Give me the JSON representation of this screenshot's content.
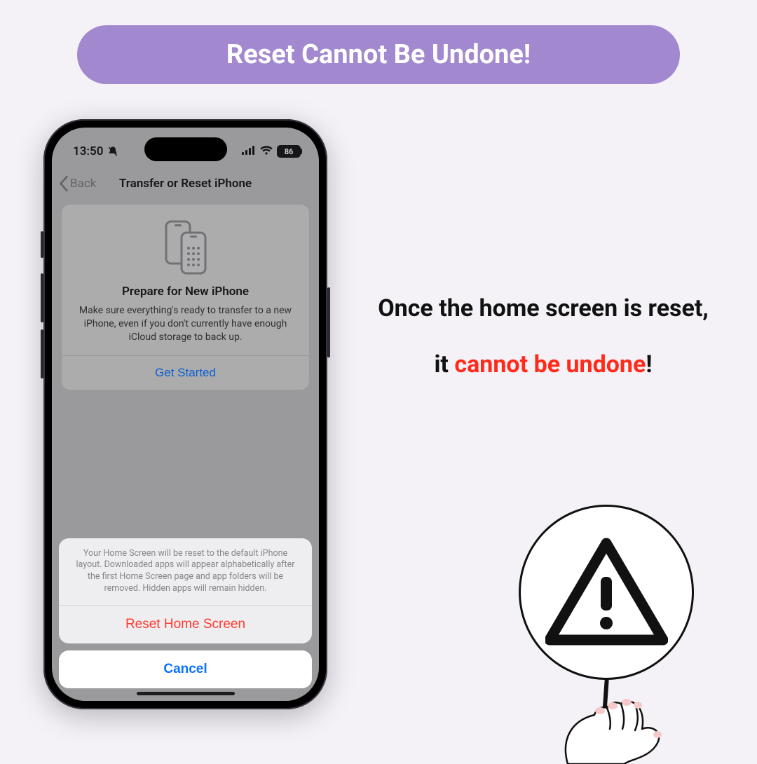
{
  "banner_title": "Reset Cannot Be Undone!",
  "statusbar": {
    "time": "13:50",
    "battery": "86"
  },
  "nav": {
    "back_label": "Back",
    "title": "Transfer or Reset iPhone"
  },
  "prepare_card": {
    "title": "Prepare for New iPhone",
    "desc": "Make sure everything's ready to transfer to a new iPhone, even if you don't currently have enough iCloud storage to back up.",
    "link": "Get Started"
  },
  "action_sheet": {
    "message": "Your Home Screen will be reset to the default iPhone layout. Downloaded apps will appear alphabetically after the first Home Screen page and app folders will be removed. Hidden apps will remain hidden.",
    "confirm": "Reset Home Screen",
    "cancel": "Cancel"
  },
  "caption": {
    "line1": "Once the home screen is reset,",
    "line2_prefix": "it ",
    "line2_emph": "cannot be undone",
    "line2_suffix": "!"
  }
}
